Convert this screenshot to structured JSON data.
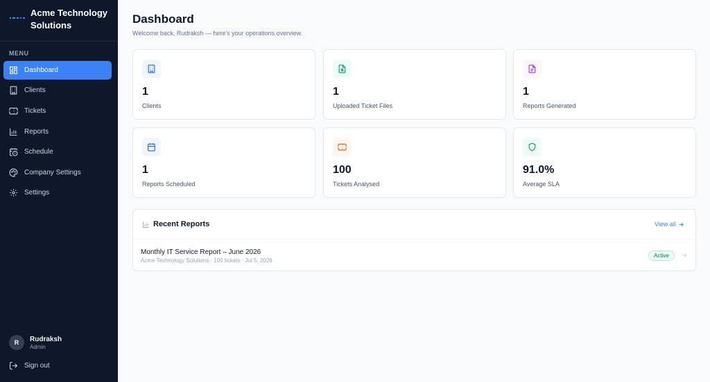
{
  "brand": {
    "name": "Acme Technology Solutions"
  },
  "sidebar": {
    "menu_heading": "MENU",
    "items": [
      {
        "label": "Dashboard",
        "icon": "dashboard-icon",
        "active": true
      },
      {
        "label": "Clients",
        "icon": "building-icon"
      },
      {
        "label": "Tickets",
        "icon": "ticket-icon"
      },
      {
        "label": "Reports",
        "icon": "bar-chart-icon"
      },
      {
        "label": "Schedule",
        "icon": "calendar-clock-icon"
      },
      {
        "label": "Company Settings",
        "icon": "palette-icon"
      },
      {
        "label": "Settings",
        "icon": "gear-icon"
      }
    ]
  },
  "user": {
    "initial": "R",
    "name": "Rudraksh",
    "role": "Admin"
  },
  "signout": {
    "label": "Sign out"
  },
  "header": {
    "title": "Dashboard",
    "subtitle": "Welcome back, Rudraksh — here's your operations overview."
  },
  "stats": [
    {
      "value": "1",
      "label": "Clients",
      "icon": "building-icon",
      "color": "#2563eb",
      "bg": "#eff6ff"
    },
    {
      "value": "1",
      "label": "Uploaded Ticket Files",
      "icon": "spreadsheet-file-icon",
      "color": "#059669",
      "bg": "#ecfdf5"
    },
    {
      "value": "1",
      "label": "Reports Generated",
      "icon": "document-icon",
      "color": "#9333ea",
      "bg": "#faf5ff"
    },
    {
      "value": "1",
      "label": "Reports Scheduled",
      "icon": "calendar-icon",
      "color": "#2563eb",
      "bg": "#eff6ff"
    },
    {
      "value": "100",
      "label": "Tickets Analysed",
      "icon": "ticket-icon",
      "color": "#ea580c",
      "bg": "#fff7ed"
    },
    {
      "value": "91.0%",
      "label": "Average SLA",
      "icon": "shield-icon",
      "color": "#059669",
      "bg": "#ecfdf5"
    }
  ],
  "recent": {
    "title": "Recent Reports",
    "view_all": "View all",
    "reports": [
      {
        "title": "Monthly IT Service Report – June 2026",
        "meta": "Acme Technology Solutions · 100 tickets · Jul 5, 2026",
        "status": "Active"
      }
    ]
  },
  "colors": {
    "sidebar_bg": "#0f172a",
    "accent": "#3b82f6",
    "page_bg": "#f8fafc"
  }
}
